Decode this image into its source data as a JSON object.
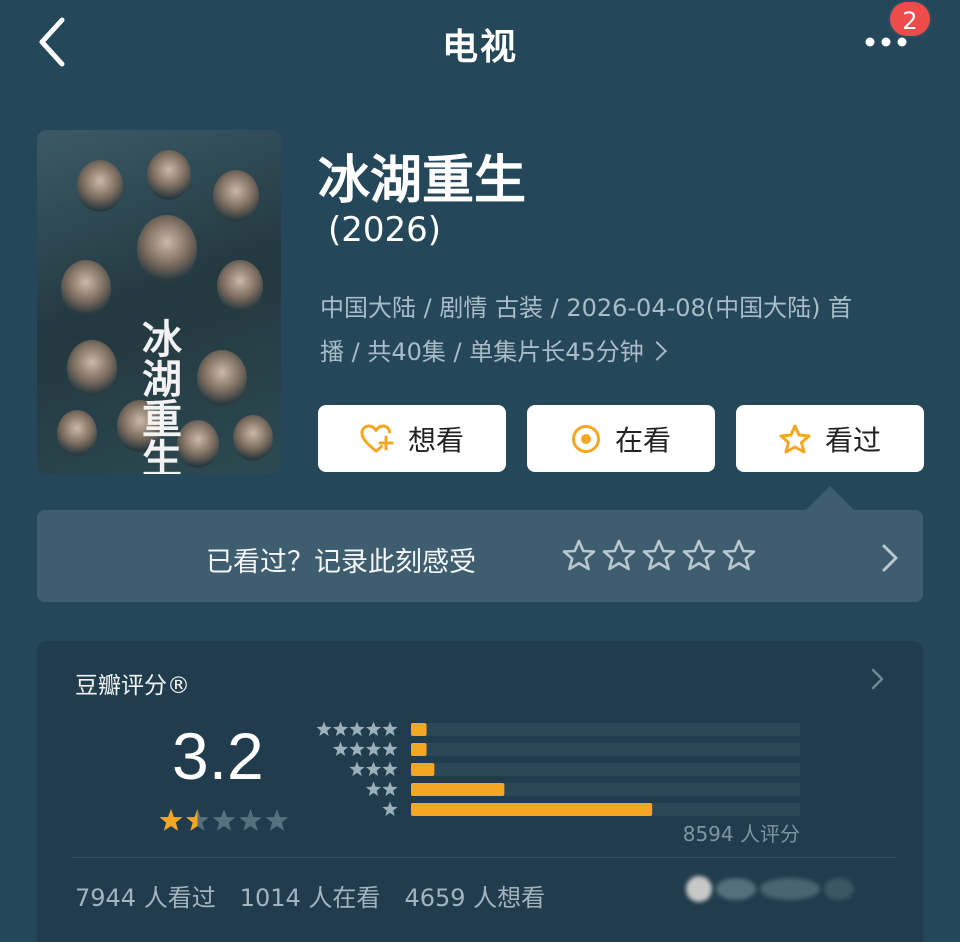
{
  "header": {
    "title": "电视",
    "notification_badge": "2"
  },
  "movie": {
    "title": "冰湖重生",
    "year": "(2026)",
    "meta_line1": "中国大陆 / 剧情 古装 / 2026-04-08(中国大陆) 首",
    "meta_line2": "播 / 共40集 / 单集片长45分钟",
    "poster_title_art": "冰湖重生"
  },
  "actions": {
    "want": "想看",
    "watching": "在看",
    "watched": "看过"
  },
  "rate_prompt": {
    "text": "已看过？记录此刻感受",
    "star_count": 5
  },
  "rating": {
    "label": "豆瓣评分®",
    "score": "3.2",
    "stars_value": 1.5,
    "distribution": [
      {
        "stars": 5,
        "fraction": 0.04
      },
      {
        "stars": 4,
        "fraction": 0.04
      },
      {
        "stars": 3,
        "fraction": 0.06
      },
      {
        "stars": 2,
        "fraction": 0.24
      },
      {
        "stars": 1,
        "fraction": 0.62
      }
    ],
    "total": "8594 人评分"
  },
  "stats": {
    "watched": "7944 人看过",
    "watching": "1014 人在看",
    "want": "4659 人想看"
  },
  "colors": {
    "background": "#25475a",
    "accent_orange": "#f5a623",
    "badge_red": "#ee4b4b"
  }
}
